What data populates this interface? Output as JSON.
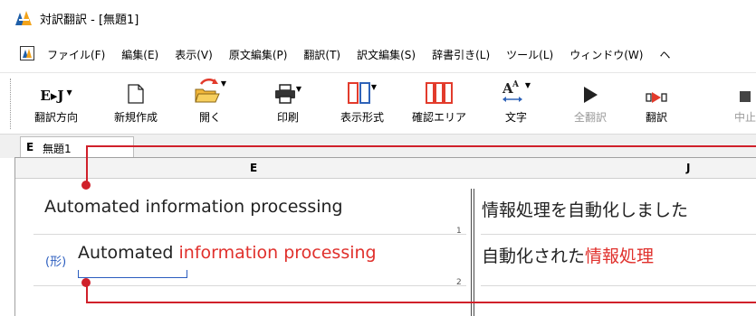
{
  "window": {
    "title": "対訳翻訳 - [無題1]"
  },
  "menubar": {
    "items": [
      "ファイル(F)",
      "編集(E)",
      "表示(V)",
      "原文編集(P)",
      "翻訳(T)",
      "訳文編集(S)",
      "辞書引き(L)",
      "ツール(L)",
      "ウィンドウ(W)",
      "ヘ"
    ]
  },
  "toolbar": {
    "direction_label": "翻訳方向",
    "direction_icon_text": "E▸J",
    "new_label": "新規作成",
    "open_label": "開く",
    "print_label": "印刷",
    "layout_label": "表示形式",
    "confirm_label": "確認エリア",
    "font_label": "文字",
    "translate_all_label": "全翻訳",
    "translate_label": "翻訳",
    "stop_label": "中止"
  },
  "tabs": [
    {
      "marker": "E",
      "name": "無題1"
    }
  ],
  "columns": {
    "source": "E",
    "target": "J"
  },
  "rows": [
    {
      "number": "1",
      "source": "Automated information processing",
      "target": "情報処理を自動化しました"
    },
    {
      "number": "2",
      "pos": "(形)",
      "source_plain": "Automated",
      "source_highlight": "information processing",
      "target_plain": "自動化された",
      "target_highlight": "情報処理"
    }
  ],
  "colors": {
    "highlight": "#e0302c",
    "callout": "#d0202a",
    "annotation": "#2b5dbf"
  }
}
